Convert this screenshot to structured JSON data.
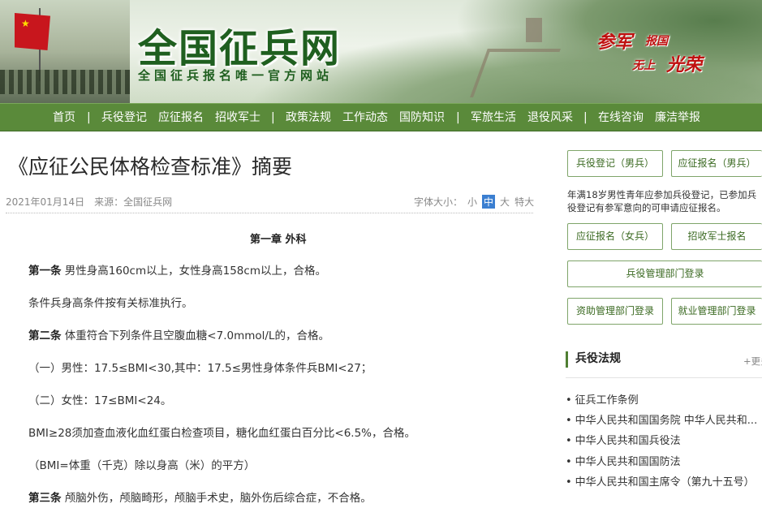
{
  "header": {
    "site_title": "全国征兵网",
    "site_subtitle": "全国征兵报名唯一官方网站",
    "slogan_part1": "参军",
    "slogan_part2": "报国",
    "slogan_part3": "无上",
    "slogan_part4": "光荣"
  },
  "nav": {
    "items": [
      "首页",
      "兵役登记",
      "应征报名",
      "招收军士",
      "政策法规",
      "工作动态",
      "国防知识",
      "军旅生活",
      "退役风采",
      "在线咨询",
      "廉洁举报"
    ]
  },
  "article": {
    "title": "《应征公民体格检查标准》摘要",
    "date": "2021年01月14日",
    "source": "来源：全国征兵网",
    "font_size_label": "字体大小：",
    "font_small": "小",
    "font_medium": "中",
    "font_large": "大",
    "font_xlarge": "特大",
    "chapter": "第一章 外科",
    "paragraphs": [
      {
        "lead": "第一条",
        "text": " 男性身高160cm以上，女性身高158cm以上，合格。"
      },
      {
        "lead": "",
        "text": "条件兵身高条件按有关标准执行。"
      },
      {
        "lead": "第二条",
        "text": " 体重符合下列条件且空腹血糖<7.0mmol/L的，合格。"
      },
      {
        "lead": "",
        "text": "（一）男性：17.5≤BMI<30,其中：17.5≤男性身体条件兵BMI<27；"
      },
      {
        "lead": "",
        "text": "（二）女性：17≤BMI<24。"
      },
      {
        "lead": "",
        "text": "BMI≥28须加查血液化血红蛋白检查项目，糖化血红蛋白百分比<6.5%，合格。"
      },
      {
        "lead": "",
        "text": "（BMI=体重（千克）除以身高（米）的平方）"
      },
      {
        "lead": "第三条",
        "text": " 颅脑外伤，颅脑畸形，颅脑手术史，脑外伤后综合症，不合格。"
      }
    ]
  },
  "sidebar": {
    "btn_register_male": "兵役登记（男兵）",
    "btn_apply_male": "应征报名（男兵）",
    "note": "年满18岁男性青年应参加兵役登记，已参加兵役登记有参军意向的可申请应征报名。",
    "btn_apply_female": "应征报名（女兵）",
    "btn_nco": "招收军士报名",
    "btn_admin_login": "兵役管理部门登录",
    "btn_aid_login": "资助管理部门登录",
    "btn_job_login": "就业管理部门登录",
    "laws_title": "兵役法规",
    "laws_more": "+更多",
    "laws": [
      "征兵工作条例",
      "中华人民共和国国务院 中华人民共和...",
      "中华人民共和国兵役法",
      "中华人民共和国国防法",
      "中华人民共和国主席令（第九十五号）"
    ]
  },
  "colors": {
    "nav_bg": "#5a8a3a",
    "brand_green": "#1f5f1f",
    "slogan_red": "#c01010",
    "active_font_btn": "#3b7fd1"
  }
}
